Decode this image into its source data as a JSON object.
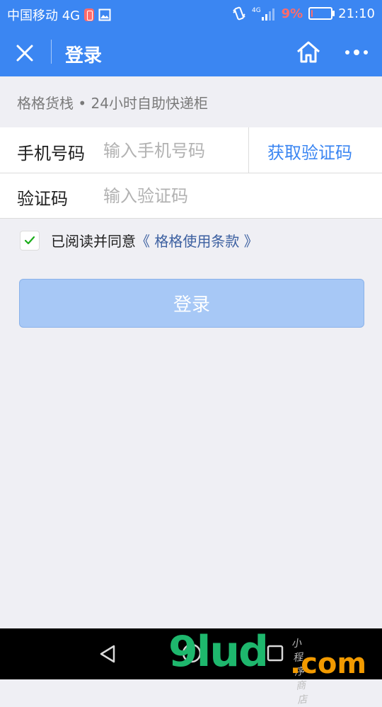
{
  "status_bar": {
    "carrier": "中国移动 4G",
    "signal_label": "4G",
    "battery_percent": "9%",
    "battery_level": 9,
    "time": "21:10"
  },
  "title_bar": {
    "title": "登录"
  },
  "subtitle": "格格货栈 • 24小时自助快递柜",
  "form": {
    "phone_label": "手机号码",
    "phone_placeholder": "输入手机号码",
    "phone_value": "",
    "get_code_label": "获取验证码",
    "code_label": "验证码",
    "code_placeholder": "输入验证码",
    "code_value": ""
  },
  "agreement": {
    "checked": true,
    "text": "已阅读并同意",
    "link_text": "《 格格使用条款 》"
  },
  "login_button": {
    "label": "登录"
  },
  "watermark": {
    "brand_main": "9lud",
    "brand_suffix": ".com",
    "small_text": "小程序商店"
  },
  "colors": {
    "brand_blue": "#3b86f2",
    "button_disabled": "#a7c8f6",
    "battery_low": "#ff6b6b",
    "background": "#efeff4"
  },
  "icons": [
    "close-icon",
    "home-icon",
    "more-icon",
    "checkmark-icon",
    "back-icon",
    "circle-home-icon",
    "recent-apps-icon",
    "vibrate-icon",
    "signal-icon",
    "photo-icon"
  ]
}
